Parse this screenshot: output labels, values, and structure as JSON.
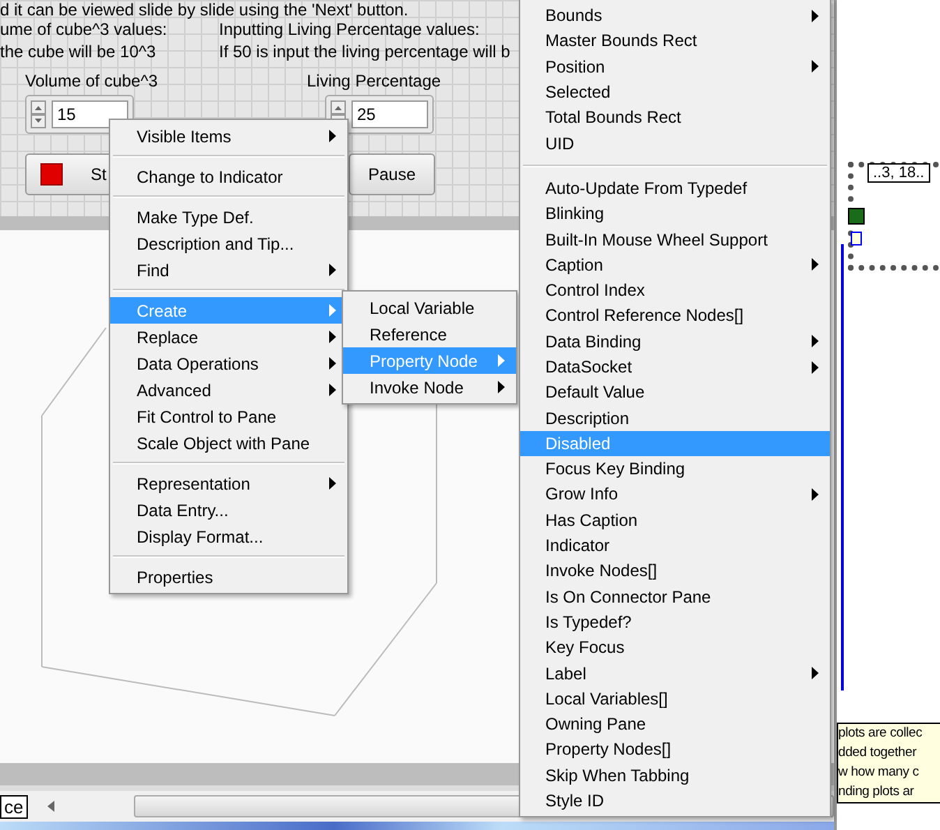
{
  "front_panel": {
    "top_note": "d it can be viewed slide by slide using the 'Next' button.",
    "notes": [
      {
        "lines": [
          "ume of cube^3 values:",
          "the cube will be 10^3"
        ]
      },
      {
        "lines": [
          "Inputting Living Percentage values:",
          "If 50 is input the living percentage will b"
        ]
      }
    ],
    "numerics": [
      {
        "label": "Volume of cube^3",
        "value": "15"
      },
      {
        "label": "Living Percentage",
        "value": "25"
      }
    ],
    "buttons": [
      {
        "label": "St",
        "kind": "stop"
      },
      {
        "label": "Pause",
        "kind": "plain"
      }
    ],
    "bottom_label": "ce"
  },
  "block_diagram": {
    "array_index": "..3, 18..",
    "comment_lines": [
      "plots are collec",
      "dded together",
      "w how many c",
      "nding plots ar"
    ]
  },
  "context_menu": [
    {
      "label": "Visible Items",
      "submenu": true,
      "selected": false
    },
    {
      "kind": "separator"
    },
    {
      "label": "Change to Indicator",
      "submenu": false,
      "selected": false
    },
    {
      "kind": "separator"
    },
    {
      "label": "Make Type Def.",
      "submenu": false,
      "selected": false
    },
    {
      "label": "Description and Tip...",
      "submenu": false,
      "selected": false
    },
    {
      "label": "Find",
      "submenu": true,
      "selected": false
    },
    {
      "kind": "separator"
    },
    {
      "label": "Create",
      "submenu": true,
      "selected": true
    },
    {
      "label": "Replace",
      "submenu": true,
      "selected": false
    },
    {
      "label": "Data Operations",
      "submenu": true,
      "selected": false
    },
    {
      "label": "Advanced",
      "submenu": true,
      "selected": false
    },
    {
      "label": "Fit Control to Pane",
      "submenu": false,
      "selected": false
    },
    {
      "label": "Scale Object with Pane",
      "submenu": false,
      "selected": false
    },
    {
      "kind": "separator"
    },
    {
      "label": "Representation",
      "submenu": true,
      "selected": false
    },
    {
      "label": "Data Entry...",
      "submenu": false,
      "selected": false
    },
    {
      "label": "Display Format...",
      "submenu": false,
      "selected": false
    },
    {
      "kind": "separator"
    },
    {
      "label": "Properties",
      "submenu": false,
      "selected": false
    }
  ],
  "create_submenu": [
    {
      "label": "Local Variable",
      "submenu": false,
      "selected": false
    },
    {
      "label": "Reference",
      "submenu": false,
      "selected": false
    },
    {
      "label": "Property Node",
      "submenu": true,
      "selected": true
    },
    {
      "label": "Invoke Node",
      "submenu": true,
      "selected": false
    }
  ],
  "property_menu": [
    {
      "label": "Bounds",
      "submenu": true,
      "selected": false
    },
    {
      "label": "Master Bounds Rect",
      "submenu": false,
      "selected": false
    },
    {
      "label": "Position",
      "submenu": true,
      "selected": false
    },
    {
      "label": "Selected",
      "submenu": false,
      "selected": false
    },
    {
      "label": "Total Bounds Rect",
      "submenu": false,
      "selected": false
    },
    {
      "label": "UID",
      "submenu": false,
      "selected": false
    },
    {
      "kind": "separator"
    },
    {
      "label": "Auto-Update From Typedef",
      "submenu": false,
      "selected": false
    },
    {
      "label": "Blinking",
      "submenu": false,
      "selected": false
    },
    {
      "label": "Built-In Mouse Wheel Support",
      "submenu": false,
      "selected": false
    },
    {
      "label": "Caption",
      "submenu": true,
      "selected": false
    },
    {
      "label": "Control Index",
      "submenu": false,
      "selected": false
    },
    {
      "label": "Control Reference Nodes[]",
      "submenu": false,
      "selected": false
    },
    {
      "label": "Data Binding",
      "submenu": true,
      "selected": false
    },
    {
      "label": "DataSocket",
      "submenu": true,
      "selected": false
    },
    {
      "label": "Default Value",
      "submenu": false,
      "selected": false
    },
    {
      "label": "Description",
      "submenu": false,
      "selected": false
    },
    {
      "label": "Disabled",
      "submenu": false,
      "selected": true
    },
    {
      "label": "Focus Key Binding",
      "submenu": false,
      "selected": false
    },
    {
      "label": "Grow Info",
      "submenu": true,
      "selected": false
    },
    {
      "label": "Has Caption",
      "submenu": false,
      "selected": false
    },
    {
      "label": "Indicator",
      "submenu": false,
      "selected": false
    },
    {
      "label": "Invoke Nodes[]",
      "submenu": false,
      "selected": false
    },
    {
      "label": "Is On Connector Pane",
      "submenu": false,
      "selected": false
    },
    {
      "label": "Is Typedef?",
      "submenu": false,
      "selected": false
    },
    {
      "label": "Key Focus",
      "submenu": false,
      "selected": false
    },
    {
      "label": "Label",
      "submenu": true,
      "selected": false
    },
    {
      "label": "Local Variables[]",
      "submenu": false,
      "selected": false
    },
    {
      "label": "Owning Pane",
      "submenu": false,
      "selected": false
    },
    {
      "label": "Property Nodes[]",
      "submenu": false,
      "selected": false
    },
    {
      "label": "Skip When Tabbing",
      "submenu": false,
      "selected": false
    },
    {
      "label": "Style ID",
      "submenu": false,
      "selected": false
    }
  ]
}
